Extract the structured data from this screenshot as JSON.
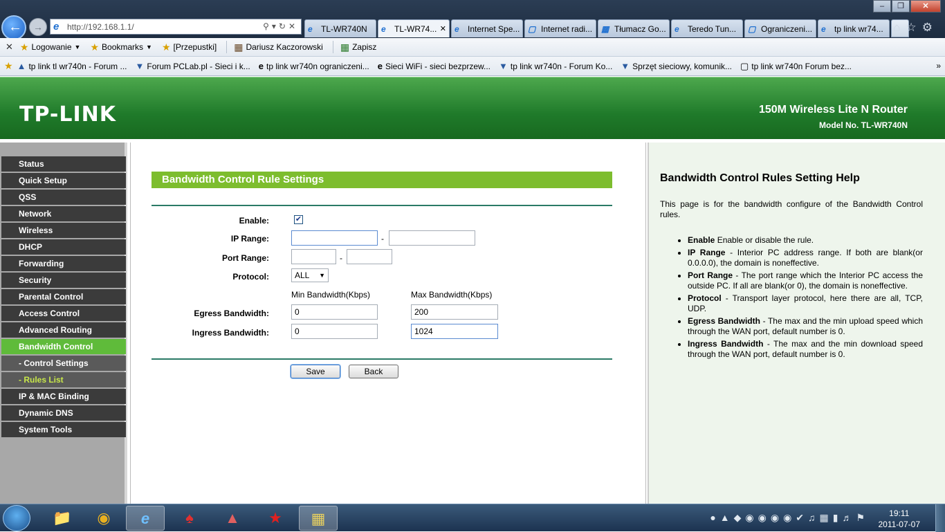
{
  "browser": {
    "url": "http://192.168.1.1/",
    "tabs": [
      {
        "label": "TL-WR740N",
        "icon": "ie-icon",
        "active": false
      },
      {
        "label": "TL-WR74...",
        "icon": "ie-icon",
        "active": true
      },
      {
        "label": "Internet Spe...",
        "icon": "ie-icon",
        "active": false
      },
      {
        "label": "Internet radi...",
        "icon": "page-icon",
        "active": false
      },
      {
        "label": "Tłumacz Go...",
        "icon": "translate-icon",
        "active": false
      },
      {
        "label": "Teredo Tun...",
        "icon": "ie-icon",
        "active": false
      },
      {
        "label": "Ograniczeni...",
        "icon": "page-icon",
        "active": false
      },
      {
        "label": "tp link wr74...",
        "icon": "ie-icon",
        "active": false
      }
    ],
    "command_bar": [
      {
        "label": "Logowanie",
        "icon": "star-icon",
        "dropdown": true
      },
      {
        "label": "Bookmarks",
        "icon": "bookmark-icon",
        "dropdown": true
      },
      {
        "label": "[Przepustki]",
        "icon": "key-icon",
        "dropdown": false
      },
      {
        "label": "Dariusz Kaczorowski",
        "icon": "user-icon",
        "dropdown": false
      },
      {
        "label": "Zapisz",
        "icon": "save-icon",
        "dropdown": false
      }
    ],
    "favorites": [
      "tp link tl wr740n - Forum ...",
      "Forum PCLab.pl - Sieci i k...",
      "tp link wr740n ograniczeni...",
      "Sieci WiFi - sieci bezprzew...",
      "tp link wr740n - Forum Ko...",
      "Sprzęt sieciowy, komunik...",
      "tp link wr740n  Forum bez..."
    ]
  },
  "router": {
    "logo": "TP-LINK",
    "product": "150M Wireless Lite N Router",
    "model": "Model No. TL-WR740N"
  },
  "menu": [
    {
      "label": "Status",
      "state": "normal"
    },
    {
      "label": "Quick Setup",
      "state": "normal"
    },
    {
      "label": "QSS",
      "state": "normal"
    },
    {
      "label": "Network",
      "state": "normal"
    },
    {
      "label": "Wireless",
      "state": "normal"
    },
    {
      "label": "DHCP",
      "state": "normal"
    },
    {
      "label": "Forwarding",
      "state": "normal"
    },
    {
      "label": "Security",
      "state": "normal"
    },
    {
      "label": "Parental Control",
      "state": "normal"
    },
    {
      "label": "Access Control",
      "state": "normal"
    },
    {
      "label": "Advanced Routing",
      "state": "normal"
    },
    {
      "label": "Bandwidth Control",
      "state": "active"
    },
    {
      "label": "- Control Settings",
      "state": "sub"
    },
    {
      "label": "- Rules List",
      "state": "subactive"
    },
    {
      "label": "IP & MAC Binding",
      "state": "normal"
    },
    {
      "label": "Dynamic DNS",
      "state": "normal"
    },
    {
      "label": "System Tools",
      "state": "normal"
    }
  ],
  "form": {
    "title": "Bandwidth Control Rule Settings",
    "enable_label": "Enable:",
    "enable_checked": true,
    "ip_range_label": "IP Range:",
    "ip_start": "",
    "ip_end": "",
    "port_range_label": "Port Range:",
    "port_start": "",
    "port_end": "",
    "protocol_label": "Protocol:",
    "protocol_value": "ALL",
    "min_bw_header": "Min Bandwidth(Kbps)",
    "max_bw_header": "Max Bandwidth(Kbps)",
    "egress_label": "Egress Bandwidth:",
    "egress_min": "0",
    "egress_max": "200",
    "ingress_label": "Ingress Bandwidth:",
    "ingress_min": "0",
    "ingress_max": "1024",
    "save_label": "Save",
    "back_label": "Back"
  },
  "help": {
    "title": "Bandwidth Control Rules Setting Help",
    "intro": "This page is for the bandwidth configure of the Bandwidth Control rules.",
    "items": [
      {
        "term": "Enable",
        "text": " Enable or disable the rule."
      },
      {
        "term": "IP Range",
        "text": " - Interior PC address range. If both are blank(or 0.0.0.0), the domain is noneffective."
      },
      {
        "term": "Port Range",
        "text": " - The port range which the Interior PC access the outside PC. If all are blank(or 0), the domain is noneffective."
      },
      {
        "term": "Protocol",
        "text": " - Transport layer protocol, here there are all, TCP, UDP."
      },
      {
        "term": "Egress Bandwidth",
        "text": " - The max and the min upload speed which through the WAN port, default number is 0."
      },
      {
        "term": "Ingress Bandwidth",
        "text": " - The max and the min download speed through the WAN port, default number is 0."
      }
    ]
  },
  "taskbar": {
    "time": "19:11",
    "date": "2011-07-07"
  },
  "colors": {
    "header_green": "#1f7a2a",
    "menu_active": "#5fbb3a",
    "section_title": "#7dbd2e",
    "menu_bg": "#3b3b3b"
  }
}
